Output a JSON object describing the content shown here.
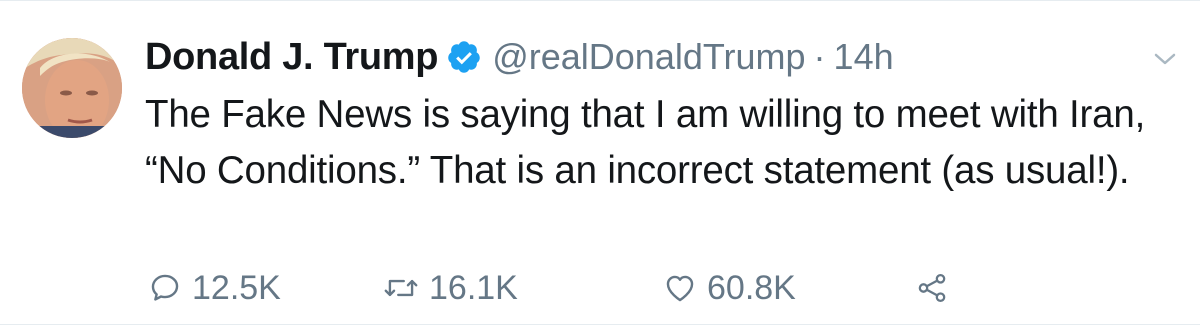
{
  "author": {
    "name": "Donald J. Trump",
    "handle": "@realDonaldTrump",
    "separator": "·",
    "time": "14h",
    "verified": true
  },
  "tweet": {
    "text": "The Fake News is saying that I am willing to meet with Iran, “No Conditions.” That is an incorrect statement (as usual!)."
  },
  "actions": {
    "replies": "12.5K",
    "retweets": "16.1K",
    "likes": "60.8K"
  },
  "icons": {
    "reply": "reply-icon",
    "retweet": "retweet-icon",
    "like": "heart-icon",
    "share": "share-icon",
    "menu": "chevron-down-icon",
    "verified": "verified-badge-icon"
  },
  "colors": {
    "text": "#14171a",
    "secondary": "#657786",
    "verified": "#1da1f2",
    "border": "#e6ecf0"
  }
}
